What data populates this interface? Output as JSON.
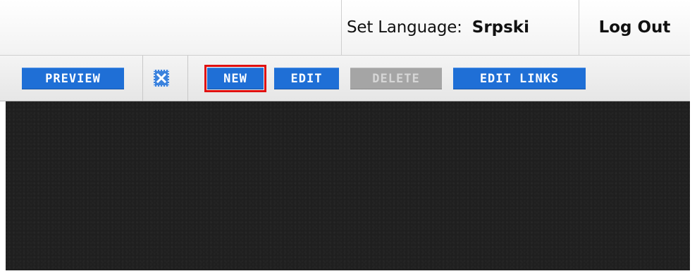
{
  "header": {
    "language_label": "Set Language:",
    "language_value": "Srpski",
    "logout_label": "Log Out"
  },
  "toolbar": {
    "preview_label": "PREVIEW",
    "close_icon": "close-x-icon",
    "new_label": "NEW",
    "edit_label": "EDIT",
    "delete_label": "DELETE",
    "edit_links_label": "EDIT LINKS"
  },
  "colors": {
    "button_blue": "#1f6fd6",
    "button_disabled": "#a5a5a5",
    "highlight_red": "#e01010",
    "content_dark": "#1f1f1f"
  }
}
